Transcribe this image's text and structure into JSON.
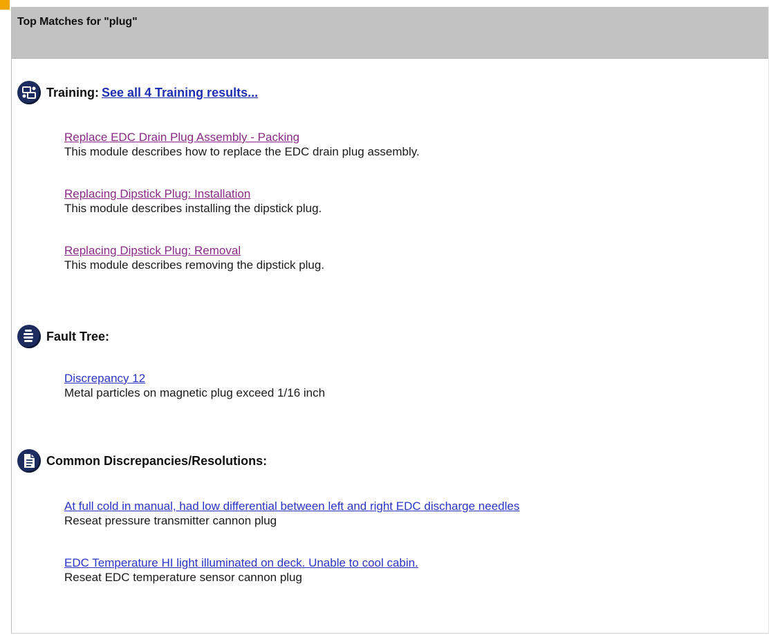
{
  "panel": {
    "title": "Top Matches for \"plug\""
  },
  "training": {
    "icon": "training-icon",
    "title": "Training:",
    "see_all_link": " See all 4 Training results...",
    "results": [
      {
        "link": "Replace EDC Drain Plug Assembly - Packing",
        "description": "This module describes how to replace the EDC drain plug assembly."
      },
      {
        "link": "Replacing Dipstick Plug: Installation",
        "description": "This module describes installing the dipstick plug."
      },
      {
        "link": "Replacing Dipstick Plug: Removal",
        "description": "This module describes removing the dipstick plug."
      }
    ]
  },
  "fault_tree": {
    "icon": "fault-tree-icon",
    "title": "Fault Tree:",
    "results": [
      {
        "link": "Discrepancy 12",
        "description": "Metal particles on magnetic plug exceed 1/16 inch"
      }
    ]
  },
  "discrepancies": {
    "icon": "document-icon",
    "title": "Common Discrepancies/Resolutions:",
    "results": [
      {
        "link": "At full cold in manual, had low differential between left and right EDC discharge needles",
        "description": "Reseat pressure transmitter cannon plug"
      },
      {
        "link": "EDC Temperature HI light illuminated on deck. Unable to cool cabin.",
        "description": "Reseat EDC temperature sensor cannon plug"
      }
    ]
  },
  "colors": {
    "header_bg": "#c2c2c2",
    "icon_bg": "#1c2c5e",
    "visited_link": "#8a2a86",
    "link": "#2a34c8"
  }
}
